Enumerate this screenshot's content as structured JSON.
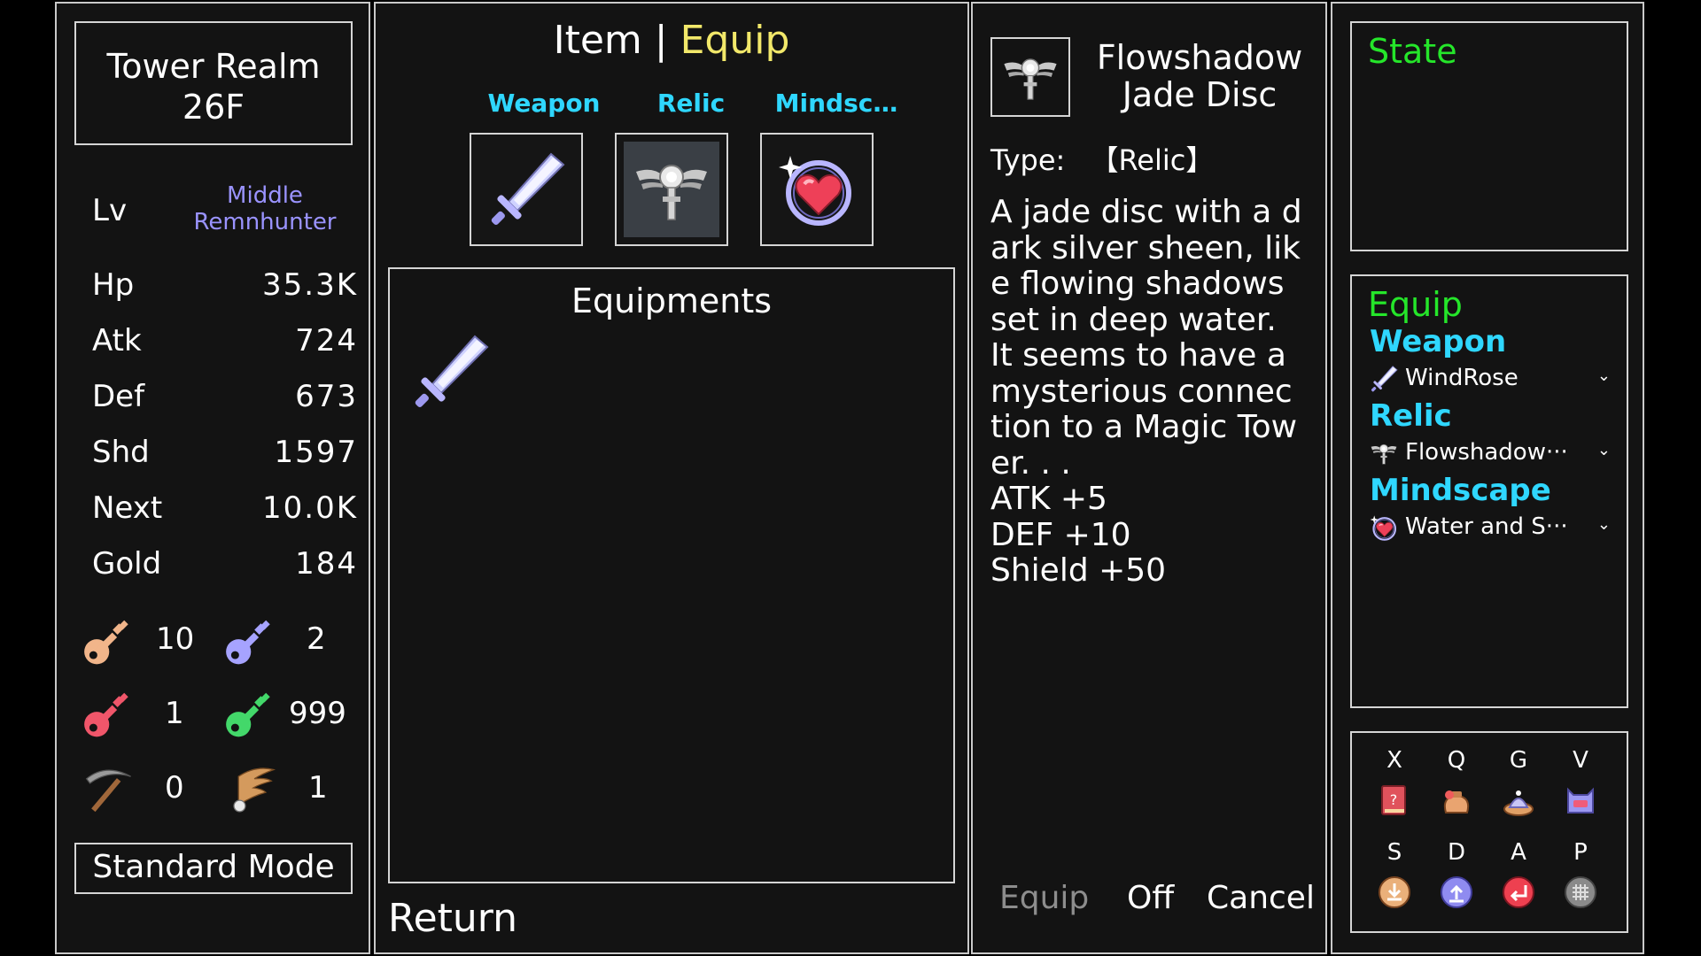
{
  "location": {
    "line1": "Tower Realm",
    "line2": "26F"
  },
  "level": {
    "label": "Lv",
    "value_line1": "Middle",
    "value_line2": "Remnhunter"
  },
  "stats": [
    {
      "label": "Hp",
      "value": "35.3K"
    },
    {
      "label": "Atk",
      "value": "724"
    },
    {
      "label": "Def",
      "value": "673"
    },
    {
      "label": "Shd",
      "value": "1597"
    },
    {
      "label": "Next",
      "value": "10.0K"
    },
    {
      "label": "Gold",
      "value": "184"
    }
  ],
  "inventory": [
    {
      "icon": "yellow-key-icon",
      "count": "10"
    },
    {
      "icon": "blue-key-icon",
      "count": "2"
    },
    {
      "icon": "red-key-icon",
      "count": "1"
    },
    {
      "icon": "green-key-icon",
      "count": "999"
    },
    {
      "icon": "pickaxe-icon",
      "count": "0"
    },
    {
      "icon": "wing-icon",
      "count": "1"
    }
  ],
  "mode_button": "Standard Mode",
  "header": {
    "tab_item": "Item",
    "separator": "|",
    "tab_equip": "Equip"
  },
  "categories": [
    {
      "label": "Weapon",
      "icon": "sword-icon"
    },
    {
      "label": "Relic",
      "icon": "jade-disc-icon"
    },
    {
      "label": "Mindsc…",
      "icon": "heart-orb-icon"
    }
  ],
  "equipments": {
    "title": "Equipments",
    "items": [
      {
        "icon": "sword-icon"
      }
    ]
  },
  "return_button": "Return",
  "detail": {
    "name_line1": "Flowshadow",
    "name_line2": "Jade Disc",
    "type_label": "Type:",
    "type_value": "【Relic】",
    "desc_lines": [
      "A jade disc with a d",
      "ark silver sheen, lik",
      "e flowing shadows",
      "set in deep water.",
      "It seems to have a",
      "mysterious connec",
      "tion to a Magic Tow",
      "er. . ."
    ],
    "bonuses": [
      "ATK +5",
      "DEF +10",
      "Shield +50"
    ],
    "actions": {
      "equip": "Equip",
      "off": "Off",
      "cancel": "Cancel"
    }
  },
  "state_panel": {
    "title": "State"
  },
  "equip_panel": {
    "title": "Equip",
    "slots": [
      {
        "category": "Weapon",
        "item": "WindRose",
        "icon": "sword-icon"
      },
      {
        "category": "Relic",
        "item": "Flowshadow···",
        "icon": "jade-disc-icon"
      },
      {
        "category": "Mindscape",
        "item": "Water and S···",
        "icon": "heart-orb-icon"
      }
    ]
  },
  "hotkeys": [
    {
      "key": "X",
      "icon": "monster-book-icon"
    },
    {
      "key": "Q",
      "icon": "bag-icon"
    },
    {
      "key": "G",
      "icon": "shop-pot-icon"
    },
    {
      "key": "V",
      "icon": "cat-badge-icon"
    },
    {
      "key": "S",
      "icon": "save-icon"
    },
    {
      "key": "D",
      "icon": "load-icon"
    },
    {
      "key": "A",
      "icon": "undo-icon"
    },
    {
      "key": "P",
      "icon": "grid-menu-icon"
    }
  ],
  "colors": {
    "accent_cyan": "#2fd7ff",
    "accent_green": "#25e62a",
    "accent_yellow": "#f2e86a",
    "level_lavender": "#9a93ff",
    "disabled_gray": "#8d8d8d"
  }
}
